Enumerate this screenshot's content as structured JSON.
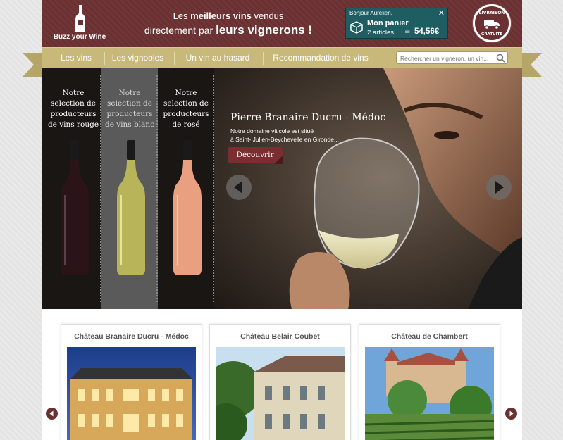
{
  "header": {
    "logo_text_plain": "Buzz your",
    "logo_text_bold": "Wine",
    "tagline_1_pre": "Les ",
    "tagline_1_bold": "meilleurs vins",
    "tagline_1_post": " vendus",
    "tagline_2_pre": "directement par ",
    "tagline_2_bold": "leurs vignerons !",
    "badge_top": "LIVRAISON",
    "badge_bottom": "GRATUITE"
  },
  "cart": {
    "greeting": "Bonjour Aurélien,",
    "close": "✕",
    "title": "Mon panier",
    "count": "2 articles",
    "equals": "=",
    "total": "54,56€"
  },
  "nav": {
    "items": [
      {
        "label": "Les vins"
      },
      {
        "label": "Les vignobles"
      },
      {
        "label": "Un vin au hasard"
      },
      {
        "label": "Recommandation de vins"
      }
    ],
    "search_placeholder": "Rechercher un vigneron, un vin..."
  },
  "hero": {
    "categories": [
      {
        "label": "Notre selection de producteurs de vins rouge",
        "color": "#2a1418"
      },
      {
        "label": "Notre selection de producteurs de vins blanc",
        "color": "#b8b45a"
      },
      {
        "label": "Notre selection de producteurs de rosé",
        "color": "#e8a080"
      }
    ],
    "slide_title": "Pierre Branaire Ducru - Médoc",
    "slide_desc_1": "Notre domaine viticole est situé",
    "slide_desc_2": "à Saint- Julien-Beychevelle en Gironde...",
    "discover_label": "Découvrir"
  },
  "products": [
    {
      "title": "Château Branaire Ducru - Médoc"
    },
    {
      "title": "Château Belair Coubet"
    },
    {
      "title": "Château de Chambert"
    }
  ],
  "colors": {
    "brand": "#6b3032",
    "nav": "#c8b97a",
    "cart": "#1e5e63"
  }
}
